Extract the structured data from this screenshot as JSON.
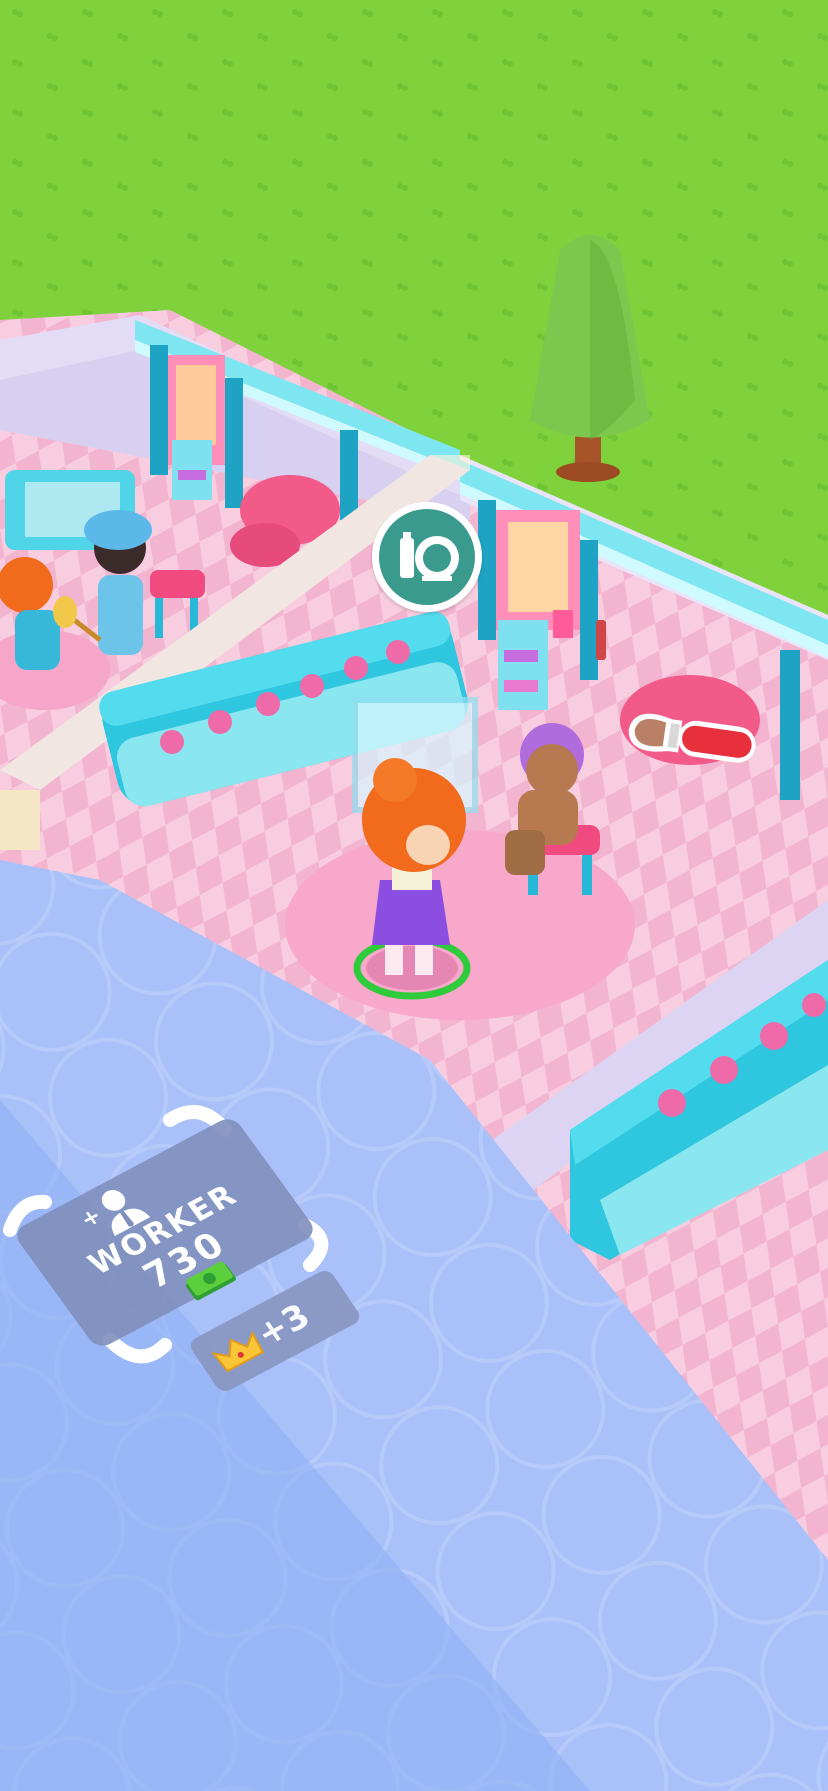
{
  "hud": {
    "station_icon": "makeup-mirror-icon",
    "task_icon": "makeup-brush-icon"
  },
  "worker_pad": {
    "icon": "add-worker-icon",
    "title": "WORKER",
    "cost": "730",
    "cost_icon": "cash-icon",
    "reward": "+3",
    "reward_icon": "crown-icon"
  },
  "colors": {
    "grass": "#7dd23a",
    "floor_pink": "#f7c6dc",
    "wall_lavender": "#dcd6f3",
    "counter_cyan": "#3fd0e3",
    "water_blue": "#9db8f7",
    "pad_gray": "#8f9bc6",
    "hair_orange": "#f26a1b"
  }
}
